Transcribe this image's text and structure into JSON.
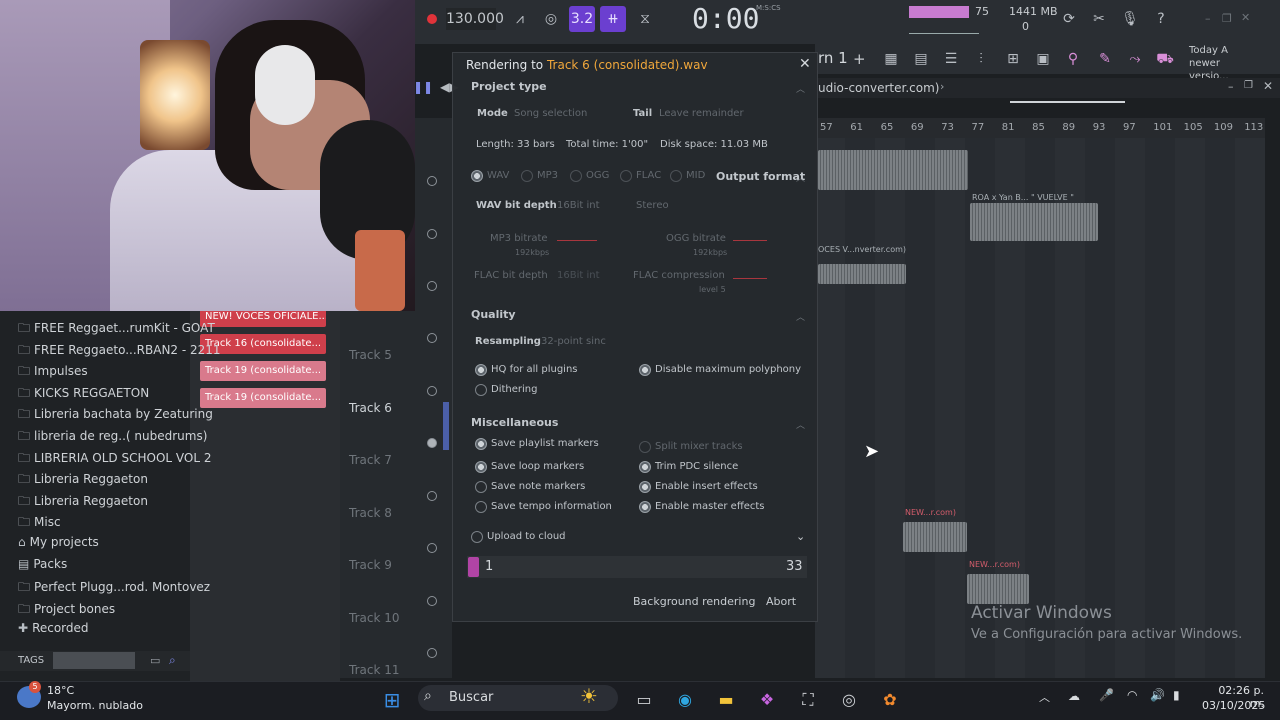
{
  "toolbar": {
    "tempo": "130.000",
    "time": "0:00",
    "time_unit": "M:S:CS",
    "monitor_value": "75",
    "memory": "1441 MB",
    "cpu": "0",
    "news_date": "Today",
    "news_text": "A newer versio..."
  },
  "pattern_bar": {
    "pattern_label": "rn 1"
  },
  "playlist": {
    "title_fragment": "udio-converter.com)",
    "ruler": [
      "57",
      "61",
      "65",
      "69",
      "73",
      "77",
      "81",
      "85",
      "89",
      "93",
      "97",
      "101",
      "105",
      "109",
      "113"
    ],
    "clips": [
      {
        "label": "ROA x Yan B... \" VUELVE \""
      },
      {
        "label": "OCES V...nverter.com)"
      },
      {
        "label": "NEW...r.com)"
      },
      {
        "label": "NEW...r.com)"
      }
    ]
  },
  "tracks": [
    {
      "name": "Track 5"
    },
    {
      "name": "Track 6"
    },
    {
      "name": "Track 7"
    },
    {
      "name": "Track 8"
    },
    {
      "name": "Track 9"
    },
    {
      "name": "Track 10"
    },
    {
      "name": "Track 11"
    }
  ],
  "picker": [
    {
      "label": "NEW! VOCES OFICIALE..."
    },
    {
      "label": "Track 16 (consolidate..."
    },
    {
      "label": "Track 19 (consolidate..."
    },
    {
      "label": "Track 19 (consolidate..."
    }
  ],
  "browser": {
    "items": [
      {
        "label": "FREE Reggaet...rumKit - GOAT"
      },
      {
        "label": "FREE Reggaeto...RBAN2 - 2211"
      },
      {
        "label": "Impulses"
      },
      {
        "label": "KICKS REGGAETON"
      },
      {
        "label": "Libreria bachata by Zeaturing"
      },
      {
        "label": "libreria de reg..( nubedrums)"
      },
      {
        "label": "LIBRERIA OLD SCHOOL VOL 2"
      },
      {
        "label": "Libreria Reggaeton"
      },
      {
        "label": "Libreria Reggaeton"
      },
      {
        "label": "Misc"
      },
      {
        "label": "My projects"
      },
      {
        "label": "Packs"
      },
      {
        "label": "Perfect Plugg...rod. Montovez"
      },
      {
        "label": "Project bones"
      },
      {
        "label": "Recorded"
      }
    ],
    "tags_label": "TAGS"
  },
  "dialog": {
    "title_prefix": "Rendering to",
    "title_file": "Track 6 (consolidated).wav",
    "project_type": "Project type",
    "mode_label": "Mode",
    "mode_value": "Song selection",
    "tail_label": "Tail",
    "tail_value": "Leave remainder",
    "length": "Length: 33 bars",
    "total_time": "Total time: 1'00\"",
    "disk_space": "Disk space: 11.03 MB",
    "formats": [
      "WAV",
      "MP3",
      "OGG",
      "FLAC",
      "MID"
    ],
    "output_format": "Output format",
    "wav_bit_depth_label": "WAV bit depth",
    "wav_bit_depth_value": "16Bit int",
    "stereo": "Stereo",
    "mp3_bitrate": "MP3 bitrate",
    "mp3_sub": "192kbps",
    "ogg_bitrate": "OGG bitrate",
    "ogg_sub": "192kbps",
    "flac_bit_depth_label": "FLAC bit depth",
    "flac_bit_depth_value": "16Bit int",
    "flac_compression": "FLAC compression",
    "flac_sub": "level 5",
    "quality": "Quality",
    "resampling_label": "Resampling",
    "resampling_value": "32-point sinc",
    "hq_plugins": "HQ for all plugins",
    "disable_polyphony": "Disable maximum polyphony",
    "dithering": "Dithering",
    "misc": "Miscellaneous",
    "save_playlist_markers": "Save playlist markers",
    "split_mixer_tracks": "Split mixer tracks",
    "save_loop_markers": "Save loop markers",
    "trim_pdc": "Trim PDC silence",
    "save_note_markers": "Save note markers",
    "enable_insert": "Enable insert effects",
    "save_tempo": "Save tempo information",
    "enable_master": "Enable master effects",
    "upload_cloud": "Upload to cloud",
    "progress_start": "1",
    "progress_end": "33",
    "background_rendering": "Background rendering",
    "abort": "Abort"
  },
  "watermark": {
    "line1": "Activar Windows",
    "line2": "Ve a Configuración para activar Windows."
  },
  "taskbar": {
    "weather_temp": "18°C",
    "weather_desc": "Mayorm. nublado",
    "weather_badge": "5",
    "search_placeholder": "Buscar",
    "time": "02:26 p. m.",
    "date": "03/10/2025"
  }
}
